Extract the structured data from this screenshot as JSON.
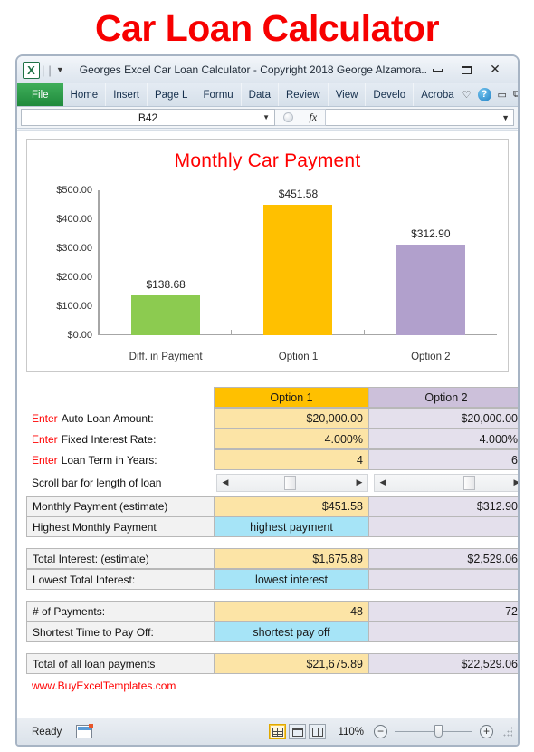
{
  "page": {
    "heading": "Car Loan Calculator"
  },
  "window": {
    "title": "Georges Excel Car Loan Calculator - Copyright 2018 George Alzamora....",
    "logo_letter": "X",
    "controls": {
      "minimize": "minimize",
      "restore": "restore",
      "close": "close"
    }
  },
  "ribbon": {
    "tabs": [
      {
        "label": "File"
      },
      {
        "label": "Home"
      },
      {
        "label": "Insert"
      },
      {
        "label": "Page L"
      },
      {
        "label": "Formu"
      },
      {
        "label": "Data"
      },
      {
        "label": "Review"
      },
      {
        "label": "View"
      },
      {
        "label": "Develo"
      },
      {
        "label": "Acroba"
      }
    ],
    "help_label": "?"
  },
  "formula_bar": {
    "name_box_value": "B42",
    "fx_label": "fx",
    "formula_value": ""
  },
  "chart_data": {
    "type": "bar",
    "title": "Monthly Car Payment",
    "xlabel": "",
    "ylabel": "",
    "categories": [
      "Diff. in Payment",
      "Option 1",
      "Option 2"
    ],
    "values": [
      138.68,
      451.58,
      312.9
    ],
    "data_labels": [
      "$138.68",
      "$451.58",
      "$312.90"
    ],
    "colors": [
      "#8CCB50",
      "#FFC000",
      "#B1A0CC"
    ],
    "ylim": [
      0,
      500
    ],
    "yticks": [
      0,
      100,
      200,
      300,
      400,
      500
    ],
    "ytick_labels": [
      "$0.00",
      "$100.00",
      "$200.00",
      "$300.00",
      "$400.00",
      "$500.00"
    ],
    "grid": false,
    "legend": "none"
  },
  "table": {
    "headers": {
      "blank": "",
      "option1": "Option 1",
      "option2": "Option 2"
    },
    "inputs": [
      {
        "enter": "Enter",
        "label": "Auto Loan Amount:",
        "option1": "$20,000.00",
        "option2": "$20,000.00"
      },
      {
        "enter": "Enter",
        "label": "Fixed Interest Rate:",
        "option1": "4.000%",
        "option2": "4.000%"
      },
      {
        "enter": "Enter",
        "label": "Loan Term in Years:",
        "option1": "4",
        "option2": "6"
      }
    ],
    "scrollbar_row": {
      "label": "Scroll bar for length of loan"
    },
    "groups": [
      {
        "rows": [
          {
            "label": "Monthly Payment (estimate)",
            "option1": "$451.58",
            "option2": "$312.90",
            "highlight": false
          },
          {
            "label": "Highest Monthly Payment",
            "option1": "highest payment",
            "option2": "",
            "highlight": true
          }
        ]
      },
      {
        "rows": [
          {
            "label": "Total Interest: (estimate)",
            "option1": "$1,675.89",
            "option2": "$2,529.06",
            "highlight": false
          },
          {
            "label": "Lowest Total Interest:",
            "option1": "lowest interest",
            "option2": "",
            "highlight": true
          }
        ]
      },
      {
        "rows": [
          {
            "label": "# of Payments:",
            "option1": "48",
            "option2": "72",
            "highlight": false
          },
          {
            "label": "Shortest Time to Pay Off:",
            "option1": "shortest pay off",
            "option2": "",
            "highlight": true
          }
        ]
      }
    ],
    "total_row": {
      "label": "Total of all loan payments",
      "option1": "$21,675.89",
      "option2": "$22,529.06"
    }
  },
  "footer_link": "www.BuyExcelTemplates.com",
  "status_bar": {
    "state": "Ready",
    "zoom": "110%",
    "views": [
      "normal-view",
      "page-layout-view",
      "page-break-view"
    ]
  },
  "colors": {
    "brand_red": "#ff0000",
    "orange": "#ffc000",
    "purple_header": "#ccc0da",
    "light_yellow": "#fce4a6",
    "light_lavender": "#e4e0ec",
    "cyan": "#a6e4f7",
    "green_bar": "#8ccb50",
    "purple_bar": "#b1a0cc"
  }
}
